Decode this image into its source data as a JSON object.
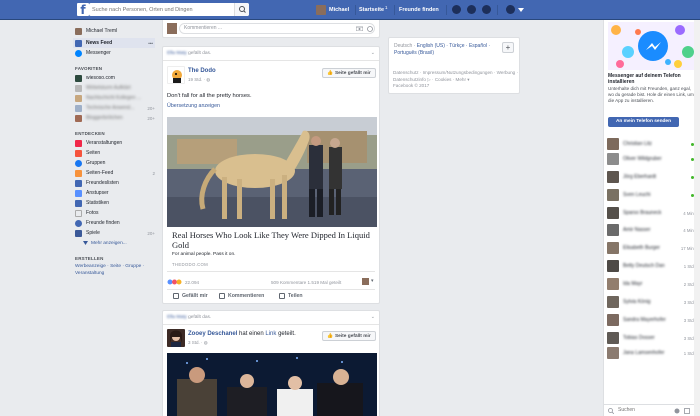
{
  "topbar": {
    "search_placeholder": "Suche nach Personen, Orten und Dingen",
    "user_name": "Michael",
    "home_label": "Startseite",
    "home_count": "1",
    "find_friends": "Freunde finden"
  },
  "sidebar": {
    "user": "Michael Treml",
    "news_feed": "News Feed",
    "messenger": "Messenger",
    "favorites_head": "FAVORITEN",
    "fav_items": [
      {
        "label": "wiesoso.com",
        "count": ""
      },
      {
        "label": "Wirbelsturm Aufklärt",
        "count": ""
      },
      {
        "label": "Nachtschicht Kollegen ...",
        "count": ""
      },
      {
        "label": "Technische Anwend...",
        "count": "20+"
      },
      {
        "label": "Bloggerbrötchen",
        "count": "20+"
      }
    ],
    "discover_head": "ENTDECKEN",
    "discover_items": [
      {
        "label": "Veranstaltungen",
        "count": ""
      },
      {
        "label": "Seiten",
        "count": ""
      },
      {
        "label": "Gruppen",
        "count": ""
      },
      {
        "label": "Seiten-Feed",
        "count": "2"
      },
      {
        "label": "Freundeslisten",
        "count": ""
      },
      {
        "label": "Anstupser",
        "count": ""
      },
      {
        "label": "Statistiken",
        "count": ""
      },
      {
        "label": "Fotos",
        "count": ""
      },
      {
        "label": "Freunde finden",
        "count": ""
      },
      {
        "label": "Spiele",
        "count": "20+"
      }
    ],
    "more": "Mehr anzeigen...",
    "create_head": "ERSTELLEN",
    "create_links": "Werbeanzeige · Seite · Gruppe · Veranstaltung"
  },
  "composer": {
    "placeholder": "Kommentieren ..."
  },
  "post1": {
    "liked_by": "Ella Maty",
    "liked_suffix": "gefällt das.",
    "author": "The Dodo",
    "meta": "19 Std. · ",
    "like_page": "Seite gefällt mir",
    "text": "Don't fall for all the pretty horses.",
    "translate": "Übersetzung anzeigen",
    "link_title": "Real Horses Who Look Like They Were Dipped In Liquid Gold",
    "link_sub": "For animal people. Pass it on.",
    "link_domain": "THEDODO.COM",
    "reactions": "22.094",
    "comments_shares": "509 Kommentare  1.519 Mal geteilt",
    "act_like": "Gefällt mir",
    "act_comment": "Kommentieren",
    "act_share": "Teilen"
  },
  "post2": {
    "liked_by": "Ella Maty",
    "liked_suffix": "gefällt das.",
    "author": "Zooey Deschanel",
    "author_suffix": " hat einen ",
    "author_link": "Link",
    "author_suffix2": " geteilt.",
    "meta": "3 Std. · ",
    "like_page": "Seite gefällt mir"
  },
  "right": {
    "lang_current": "Deutsch",
    "lang_links": "English (US) · Türkçe · Español · Português (Brasil)",
    "add": "+",
    "footer": "Datenschutz · Impressum/Nutzungsbedingungen · Werbung · Datenschutzinfo ▷ · Cookies · Mehr ▾",
    "copyright": "Facebook © 2017"
  },
  "chat": {
    "ad_title": "Messenger auf deinem Telefon installieren",
    "ad_text": "Unterhalte dich mit Freunden, ganz egal, wo du gerade bist. Hole dir einen Link, um die App zu installieren.",
    "ad_button": "An mein Telefon senden",
    "contacts": [
      {
        "name": "Christian Litz",
        "status": "dot"
      },
      {
        "name": "Oliver Wildgruber",
        "status": "dot"
      },
      {
        "name": "Jörg Eberhardt",
        "status": "dot"
      },
      {
        "name": "Sven Leuchi",
        "status": "dot"
      },
      {
        "name": "Sparso Brauneck",
        "status": "4 Min."
      },
      {
        "name": "Amir Nasser",
        "status": "4 Min."
      },
      {
        "name": "Elisabeth Burger",
        "status": "17 Min."
      },
      {
        "name": "Betty Deutsch Dan",
        "status": "1 Std."
      },
      {
        "name": "Ida Mayr",
        "status": "2 Std."
      },
      {
        "name": "Sylvia König",
        "status": "3 Std."
      },
      {
        "name": "Sandra Mayerhofer",
        "status": "3 Std."
      },
      {
        "name": "Tobias Dosser",
        "status": "3 Std."
      },
      {
        "name": "Jana Lamsenhofer",
        "status": "1 Std."
      }
    ],
    "search_placeholder": "Suchen"
  }
}
